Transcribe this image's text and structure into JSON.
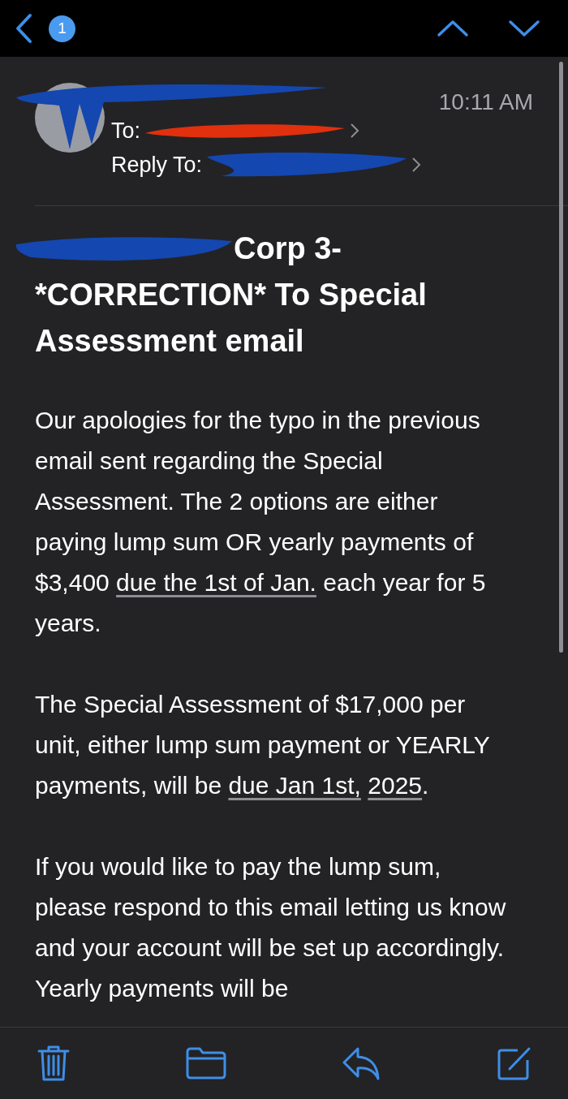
{
  "nav_bar": {
    "unread_count": "1"
  },
  "message": {
    "time": "10:11 AM",
    "to_label": "To:",
    "reply_to_label": "Reply To:",
    "subject_visible": "Corp 3-",
    "subject_rest": "*CORRECTION* To Special Assessment email",
    "paragraphs": [
      [
        {
          "kind": "text",
          "text": "Our apologies for the typo in the previous email sent regarding the Special Assessment. The 2 options are either paying lump sum OR yearly payments of $3,400 "
        },
        {
          "kind": "link",
          "text": "due the 1st of Jan."
        },
        {
          "kind": "text",
          "text": " each year for 5 years."
        }
      ],
      [
        {
          "kind": "text",
          "text": "The Special Assessment of $17,000 per unit, either lump sum payment or YEARLY payments, will be "
        },
        {
          "kind": "link",
          "text": "due Jan 1st,"
        },
        {
          "kind": "link",
          "text": "2025"
        },
        {
          "kind": "text",
          "text": "."
        }
      ],
      [
        {
          "kind": "text",
          "text": "If you would like to pay the lump sum, please respond to this email letting us know and your account will be set up accordingly. Yearly payments will be"
        }
      ]
    ]
  }
}
